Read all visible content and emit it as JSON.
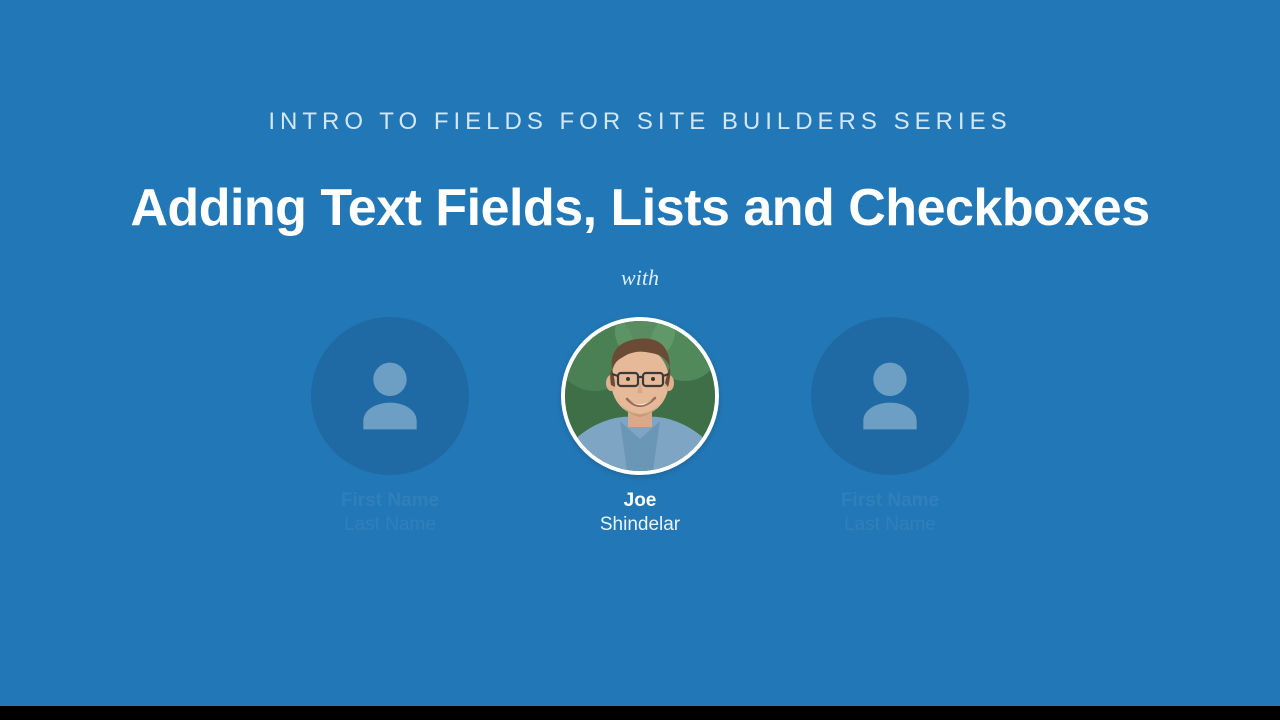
{
  "slide": {
    "series": "INTRO TO FIELDS FOR SITE BUILDERS SERIES",
    "title": "Adding Text Fields, Lists and Checkboxes",
    "with_label": "with"
  },
  "presenters": {
    "left": {
      "first": "First Name",
      "last": "Last Name"
    },
    "center": {
      "first": "Joe",
      "last": "Shindelar"
    },
    "right": {
      "first": "First Name",
      "last": "Last Name"
    }
  }
}
